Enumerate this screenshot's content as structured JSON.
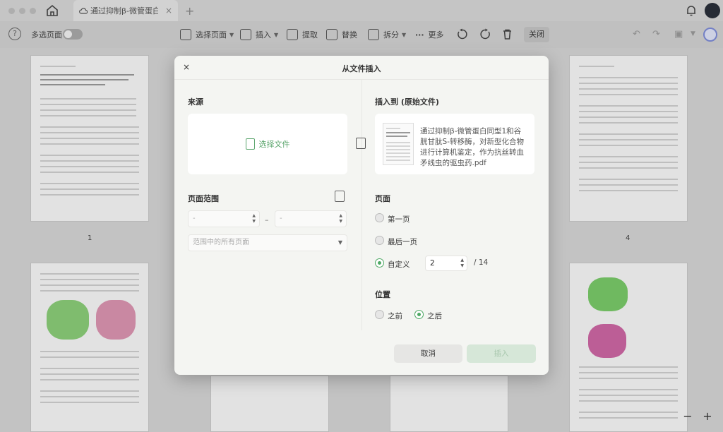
{
  "titlebar": {
    "tab_title": "通过抑制β-微管蛋白同",
    "tab_close": "×",
    "new_tab": "+"
  },
  "toolbar": {
    "multi_select_label": "多选页面",
    "multi_select_on": false,
    "select_pages": "选择页面",
    "insert": "插入",
    "extract": "提取",
    "replace": "替换",
    "split": "拆分",
    "more": "更多",
    "close": "关闭"
  },
  "canvas": {
    "page_numbers": [
      "1",
      "4"
    ]
  },
  "dialog": {
    "close_glyph": "×",
    "title": "从文件插入",
    "source_label": "来源",
    "choose_file": "选择文件",
    "insert_to_label": "插入到 (原始文件)",
    "target_file": "通过抑制β-微管蛋白同型1和谷胱甘肽S-转移酶，对新型化合物进行计算机鉴定，作为抗丝转血矛线虫的驱虫药.pdf",
    "page_range_label": "页面范围",
    "range_from": "-",
    "range_sep": "–",
    "range_to": "-",
    "range_mode": "范围中的所有页面",
    "page_label": "页面",
    "page_options": {
      "first": "第一页",
      "last": "最后一页",
      "custom": "自定义"
    },
    "page_selected": "custom",
    "custom_page_value": "2",
    "page_total": "/ 14",
    "position_label": "位置",
    "position_options": {
      "before": "之前",
      "after": "之后"
    },
    "position_selected": "after",
    "cancel": "取消",
    "insert": "插入"
  },
  "zoom": {
    "minus": "−",
    "plus": "+"
  },
  "colors": {
    "accent": "#4ea865",
    "disabled_button": "#d6e7d8"
  }
}
